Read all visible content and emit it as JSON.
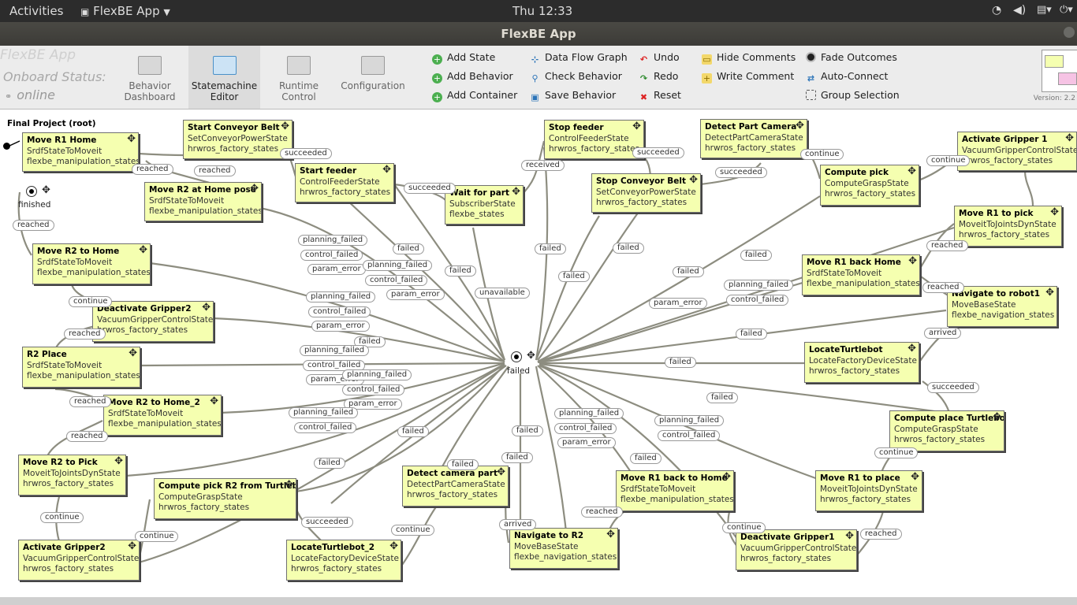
{
  "topbar": {
    "activities": "Activities",
    "app": "FlexBE App",
    "clock": "Thu 12:33"
  },
  "window": {
    "title": "FlexBE App"
  },
  "toolbar": {
    "brand": "FlexBE App",
    "onboard_label": "Onboard Status:",
    "onboard_value": "online",
    "nav": [
      {
        "label1": "Behavior",
        "label2": "Dashboard",
        "icon": "dashboard-icon"
      },
      {
        "label1": "Statemachine",
        "label2": "Editor",
        "icon": "statemachine-icon",
        "active": true
      },
      {
        "label1": "Runtime",
        "label2": "Control",
        "icon": "runtime-icon"
      },
      {
        "label1": "Configuration",
        "label2": "",
        "icon": "gear-icon"
      }
    ],
    "actions": [
      {
        "label": "Add State",
        "icon": "add-icon"
      },
      {
        "label": "Add Behavior",
        "icon": "add-icon"
      },
      {
        "label": "Add Container",
        "icon": "add-icon"
      },
      {
        "label": "Data Flow Graph",
        "icon": "dataflow-icon"
      },
      {
        "label": "Check Behavior",
        "icon": "magnifier-icon"
      },
      {
        "label": "Save Behavior",
        "icon": "save-icon"
      },
      {
        "label": "Undo",
        "icon": "undo-icon"
      },
      {
        "label": "Redo",
        "icon": "redo-icon"
      },
      {
        "label": "Reset",
        "icon": "reset-icon"
      },
      {
        "label": "Hide Comments",
        "icon": "comment-icon"
      },
      {
        "label": "Write Comment",
        "icon": "write-comment-icon"
      },
      {
        "label": "Fade Outcomes",
        "icon": "fade-icon"
      },
      {
        "label": "Auto-Connect",
        "icon": "autoconnect-icon"
      },
      {
        "label": "Group Selection",
        "icon": "group-selection-icon"
      }
    ],
    "version": "Version: 2.2"
  },
  "canvas": {
    "root": "Final Project (root)",
    "finished": "finished",
    "failed": "failed",
    "states": [
      {
        "name": "Move R1 Home",
        "class": "SrdfStateToMoveit",
        "pkg": "flexbe_manipulation_states"
      },
      {
        "name": "Start Conveyor Belt",
        "class": "SetConveyorPowerState",
        "pkg": "hrwros_factory_states"
      },
      {
        "name": "Move R2 at Home pose",
        "class": "SrdfStateToMoveit",
        "pkg": "flexbe_manipulation_states"
      },
      {
        "name": "Start feeder",
        "class": "ControlFeederState",
        "pkg": "hrwros_factory_states"
      },
      {
        "name": "Wait for part",
        "class": "SubscriberState",
        "pkg": "flexbe_states"
      },
      {
        "name": "Stop feeder",
        "class": "ControlFeederState",
        "pkg": "hrwros_factory_states"
      },
      {
        "name": "Stop Conveyor Belt",
        "class": "SetConveyorPowerState",
        "pkg": "hrwros_factory_states"
      },
      {
        "name": "Detect Part Camera",
        "class": "DetectPartCameraState",
        "pkg": "hrwros_factory_states"
      },
      {
        "name": "Compute pick",
        "class": "ComputeGraspState",
        "pkg": "hrwros_factory_states"
      },
      {
        "name": "Activate Gripper 1",
        "class": "VacuumGripperControlState",
        "pkg": "hrwros_factory_states"
      },
      {
        "name": "Move R1 to pick",
        "class": "MoveitToJointsDynState",
        "pkg": "hrwros_factory_states"
      },
      {
        "name": "Move R1 back Home",
        "class": "SrdfStateToMoveit",
        "pkg": "flexbe_manipulation_states"
      },
      {
        "name": "Navigate to robot1",
        "class": "MoveBaseState",
        "pkg": "flexbe_navigation_states"
      },
      {
        "name": "LocateTurtlebot",
        "class": "LocateFactoryDeviceState",
        "pkg": "hrwros_factory_states"
      },
      {
        "name": "Compute place Turtlebot",
        "class": "ComputeGraspState",
        "pkg": "hrwros_factory_states"
      },
      {
        "name": "Move R1 to place",
        "class": "MoveitToJointsDynState",
        "pkg": "hrwros_factory_states"
      },
      {
        "name": "Deactivate Gripper1",
        "class": "VacuumGripperControlState",
        "pkg": "hrwros_factory_states"
      },
      {
        "name": "Move R1 back to Home",
        "class": "SrdfStateToMoveit",
        "pkg": "flexbe_manipulation_states"
      },
      {
        "name": "Navigate to R2",
        "class": "MoveBaseState",
        "pkg": "flexbe_navigation_states"
      },
      {
        "name": "Detect camera part",
        "class": "DetectPartCameraState",
        "pkg": "hrwros_factory_states"
      },
      {
        "name": "LocateTurtlebot_2",
        "class": "LocateFactoryDeviceState",
        "pkg": "hrwros_factory_states"
      },
      {
        "name": "Compute pick R2 from Turtlebot",
        "class": "ComputeGraspState",
        "pkg": "hrwros_factory_states"
      },
      {
        "name": "Activate Gripper2",
        "class": "VacuumGripperControlState",
        "pkg": "hrwros_factory_states"
      },
      {
        "name": "Move R2 to Pick",
        "class": "MoveitToJointsDynState",
        "pkg": "hrwros_factory_states"
      },
      {
        "name": "Move R2 to Home_2",
        "class": "SrdfStateToMoveit",
        "pkg": "flexbe_manipulation_states"
      },
      {
        "name": "R2 Place",
        "class": "SrdfStateToMoveit",
        "pkg": "flexbe_manipulation_states"
      },
      {
        "name": "Deactivate Gripper2",
        "class": "VacuumGripperControlState",
        "pkg": "hrwros_factory_states"
      },
      {
        "name": "Move R2 to Home",
        "class": "SrdfStateToMoveit",
        "pkg": "flexbe_manipulation_states"
      }
    ],
    "outcomes": [
      "reached",
      "reached",
      "succeeded",
      "succeeded",
      "received",
      "succeeded",
      "succeeded",
      "continue",
      "continue",
      "reached",
      "reached",
      "arrived",
      "succeeded",
      "continue",
      "reached",
      "continue",
      "reached",
      "arrived",
      "continue",
      "succeeded",
      "continue",
      "continue",
      "reached",
      "reached",
      "reached",
      "continue",
      "reached",
      "planning_failed",
      "control_failed",
      "param_error",
      "failed",
      "planning_failed",
      "control_failed",
      "param_error",
      "planning_failed",
      "control_failed",
      "param_error",
      "failed",
      "planning_failed",
      "control_failed",
      "param_error",
      "planning_failed",
      "control_failed",
      "param_error",
      "failed",
      "planning_failed",
      "control_failed",
      "failed",
      "unavailable",
      "failed",
      "failed",
      "failed",
      "failed",
      "failed",
      "planning_failed",
      "control_failed",
      "param_error",
      "failed",
      "failed",
      "failed",
      "failed",
      "planning_failed",
      "control_failed",
      "param_error",
      "failed",
      "failed",
      "failed",
      "planning_failed",
      "control_failed",
      "failed",
      "failed"
    ]
  }
}
